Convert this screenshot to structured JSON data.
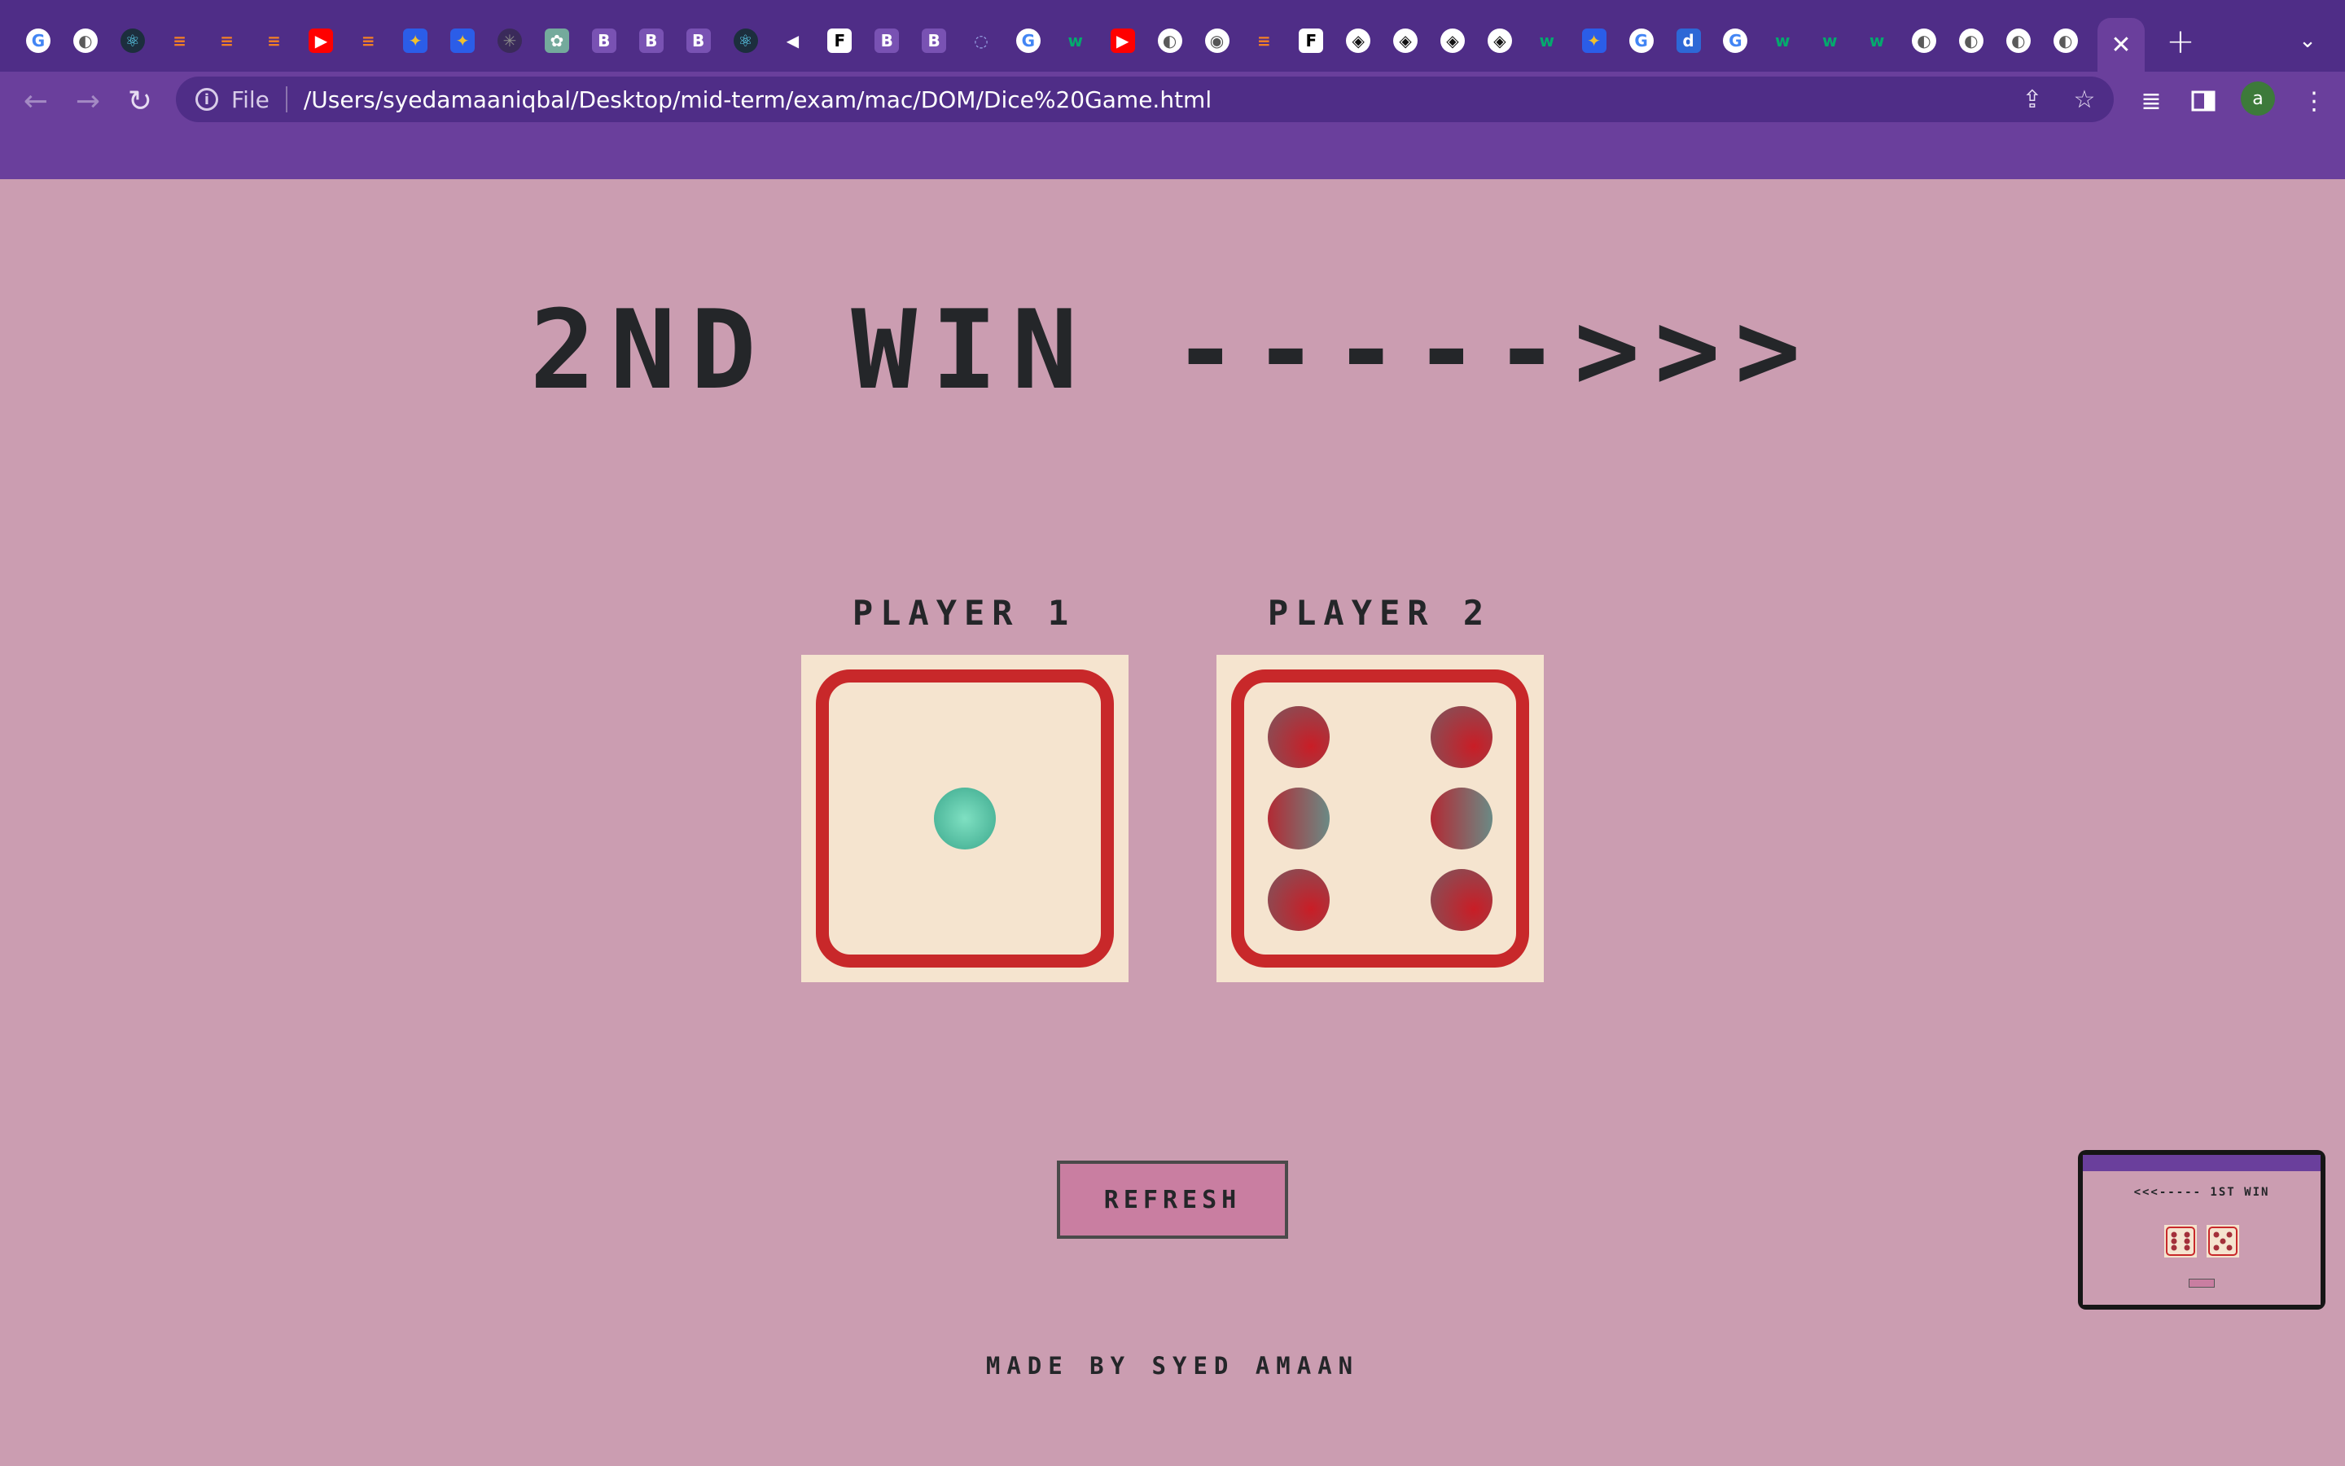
{
  "browser": {
    "tabs": [
      {
        "icon": "google-icon"
      },
      {
        "icon": "globe-icon"
      },
      {
        "icon": "react-icon"
      },
      {
        "icon": "stackoverflow-icon"
      },
      {
        "icon": "stackoverflow-icon"
      },
      {
        "icon": "stackoverflow-icon"
      },
      {
        "icon": "youtube-icon"
      },
      {
        "icon": "stackoverflow-icon"
      },
      {
        "icon": "app-icon"
      },
      {
        "icon": "app-icon"
      },
      {
        "icon": "generic-icon"
      },
      {
        "icon": "openai-icon"
      },
      {
        "icon": "bootstrap-icon",
        "text": "B"
      },
      {
        "icon": "bootstrap-icon",
        "text": "B"
      },
      {
        "icon": "bootstrap-icon",
        "text": "B"
      },
      {
        "icon": "react-icon"
      },
      {
        "icon": "speaker-icon"
      },
      {
        "icon": "frame-icon",
        "text": "F"
      },
      {
        "icon": "bootstrap-icon",
        "text": "B"
      },
      {
        "icon": "bootstrap-icon",
        "text": "B"
      },
      {
        "icon": "loading-icon"
      },
      {
        "icon": "google-icon"
      },
      {
        "icon": "w3schools-icon",
        "text": "w"
      },
      {
        "icon": "youtube-icon"
      },
      {
        "icon": "globe-icon"
      },
      {
        "icon": "chrome-icon"
      },
      {
        "icon": "stackoverflow-icon"
      },
      {
        "icon": "frame-icon",
        "text": "F"
      },
      {
        "icon": "codepen-icon"
      },
      {
        "icon": "codepen-icon"
      },
      {
        "icon": "codepen-icon"
      },
      {
        "icon": "codepen-icon"
      },
      {
        "icon": "w3schools-icon",
        "text": "w"
      },
      {
        "icon": "app-icon"
      },
      {
        "icon": "google-icon"
      },
      {
        "icon": "dailydev-icon",
        "text": "d"
      },
      {
        "icon": "google-icon"
      },
      {
        "icon": "w3schools-icon",
        "text": "w"
      },
      {
        "icon": "w3schools-icon",
        "text": "w"
      },
      {
        "icon": "w3schools-icon",
        "text": "w"
      },
      {
        "icon": "globe-icon"
      },
      {
        "icon": "globe-icon"
      },
      {
        "icon": "globe-icon"
      },
      {
        "icon": "globe-icon"
      }
    ],
    "address": {
      "scheme": "File",
      "url": "/Users/syedamaaniqbal/Desktop/mid-term/exam/mac/DOM/Dice%20Game.html"
    },
    "profile_initial": "a",
    "colors": {
      "frame": "#4f2d87",
      "toolbar": "#6a3f9c"
    }
  },
  "game": {
    "title": "2ND WIN ----->>>",
    "player1": {
      "label": "PLAYER 1",
      "die_value": 1
    },
    "player2": {
      "label": "PLAYER 2",
      "die_value": 6
    },
    "refresh_label": "REFRESH",
    "footer": "MADE BY SYED AMAAN",
    "colors": {
      "background": "#cb9db1",
      "die_face": "#f5e4cf",
      "die_border": "#c8282a",
      "button": "#c97ea1"
    }
  },
  "thumbnail": {
    "title": "<<<----- 1ST WIN"
  }
}
